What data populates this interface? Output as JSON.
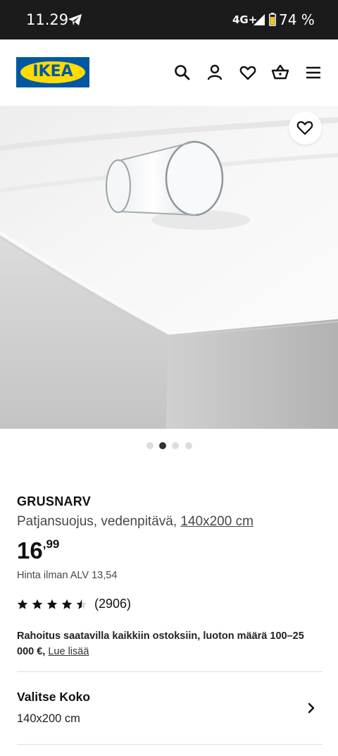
{
  "status_bar": {
    "time": "11.29",
    "network": "4G+",
    "battery": "74 %",
    "icons": [
      "telegram-icon",
      "signal-icon",
      "battery-icon"
    ]
  },
  "header": {
    "logo_text": "IKEA",
    "icons": [
      "search-icon",
      "account-icon",
      "favourites-icon",
      "basket-icon",
      "menu-icon"
    ],
    "brand_colors": {
      "blue": "#0058a3",
      "yellow": "#ffdb00"
    }
  },
  "gallery": {
    "slide_count": 4,
    "active_slide": 2,
    "favourite_icon": "heart-icon"
  },
  "product": {
    "name": "GRUSNARV",
    "description": "Patjansuojus, vedenpitävä,",
    "size_link": "140x200 cm",
    "price_integer": "16",
    "price_decimal": ",99",
    "vat_text": "Hinta ilman ALV 13,54",
    "rating_value": 4.5,
    "rating_max": 5,
    "review_count": "(2906)",
    "financing_text": "Rahoitus saatavilla kaikkiin ostoksiin, luoton määrä 100–25 000 €,",
    "financing_link": "Lue lisää"
  },
  "size_selector": {
    "title": "Valitse Koko",
    "value": "140x200 cm",
    "icon": "chevron-right-icon"
  }
}
